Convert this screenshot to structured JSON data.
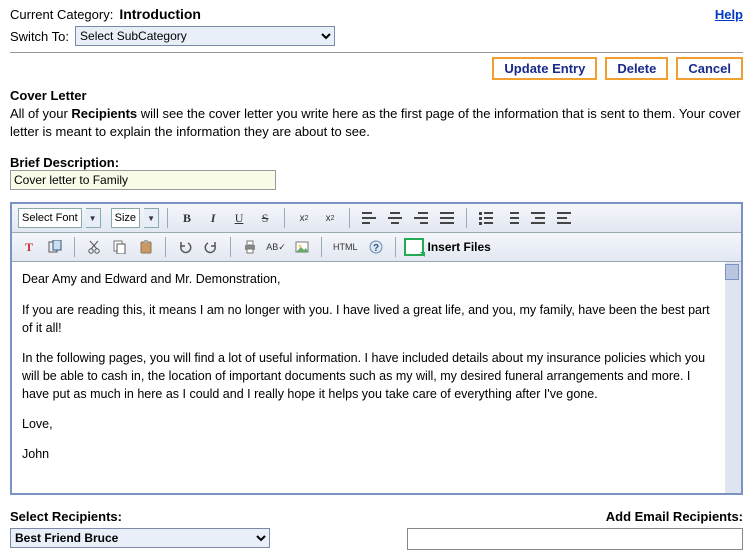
{
  "header": {
    "current_label": "Current Category:",
    "current_value": "Introduction",
    "help": "Help",
    "switch_label": "Switch To:",
    "switch_value": "Select SubCategory"
  },
  "buttons": {
    "update": "Update Entry",
    "delete": "Delete",
    "cancel": "Cancel"
  },
  "cover": {
    "title": "Cover Letter",
    "desc_pre": "All of your ",
    "desc_bold": "Recipients",
    "desc_post": " will see the cover letter you write here as the first page of the information that is sent to them. Your cover letter is meant to explain the information they are about to see."
  },
  "brief": {
    "label": "Brief Description:",
    "value": "Cover letter to Family"
  },
  "toolbar": {
    "font_label": "Select Font",
    "size_label": "Size",
    "html_label": "HTML",
    "insert_files": "Insert Files"
  },
  "body": {
    "p1": "Dear Amy and Edward and Mr. Demonstration,",
    "p2": "If you are reading this, it means I am no longer with you. I have lived a great life, and you, my family, have been the best part of it all!",
    "p3": "In the following pages, you will find a lot of useful information. I have included details about my insurance policies which you will be able to cash in, the location of important documents such as my will, my desired funeral arrangements and more. I have put as much in here as I could and I really hope it helps you take care of everything after I've gone.",
    "p4": "Love,",
    "p5": "John"
  },
  "recipients": {
    "select_label": "Select Recipients:",
    "add_label": "Add Email Recipients:",
    "selected": "Best Friend Bruce"
  }
}
